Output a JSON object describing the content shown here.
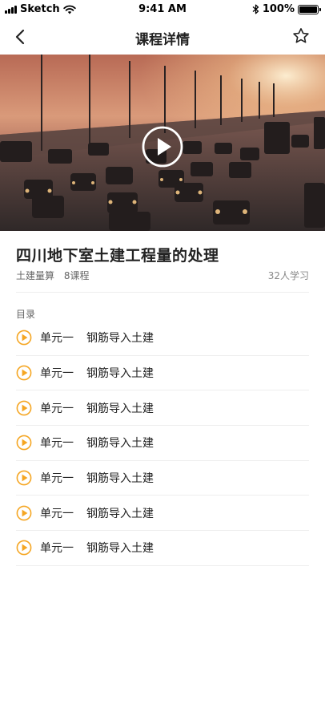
{
  "status_bar": {
    "carrier": "Sketch",
    "time": "9:41 AM",
    "battery_percent": "100%",
    "battery_level": 1.0
  },
  "nav": {
    "title": "课程详情",
    "back_icon": "chevron-left-icon",
    "favorite_icon": "star-outline-icon"
  },
  "video": {
    "play_icon": "play-circle-icon"
  },
  "course": {
    "title": "四川地下室土建工程量的处理",
    "category": "土建量算",
    "lesson_count": "8课程",
    "learners": "32人学习"
  },
  "toc": {
    "label": "目录",
    "items": [
      {
        "unit": "单元一",
        "name": "钢筋导入土建"
      },
      {
        "unit": "单元一",
        "name": "钢筋导入土建"
      },
      {
        "unit": "单元一",
        "name": "钢筋导入土建"
      },
      {
        "unit": "单元一",
        "name": "钢筋导入土建"
      },
      {
        "unit": "单元一",
        "name": "钢筋导入土建"
      },
      {
        "unit": "单元一",
        "name": "钢筋导入土建"
      },
      {
        "unit": "单元一",
        "name": "钢筋导入土建"
      }
    ]
  },
  "colors": {
    "accent": "#F5A623",
    "title_text": "#222222",
    "meta_text": "#666666",
    "divider": "#EEEEEE"
  }
}
